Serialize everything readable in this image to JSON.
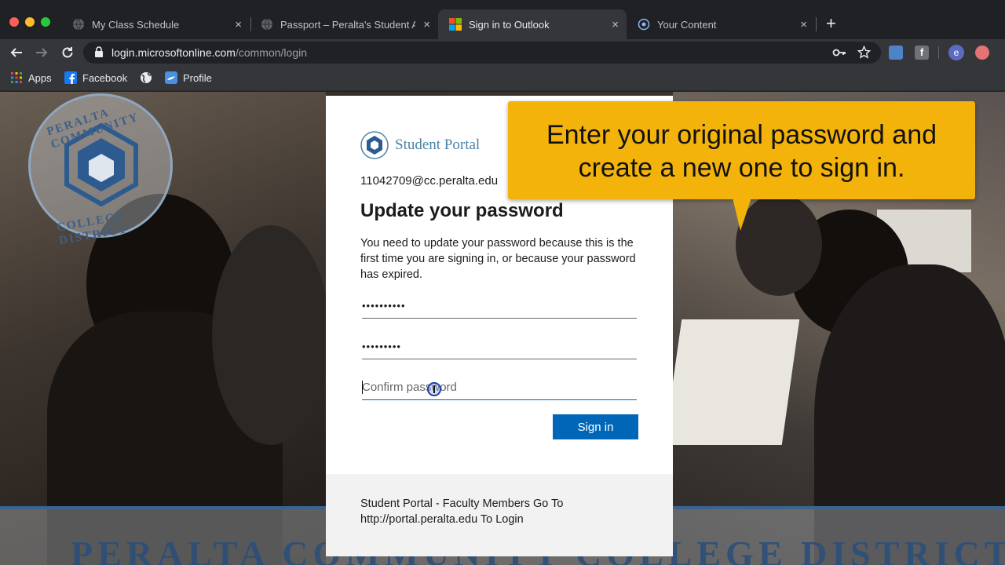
{
  "browser": {
    "tabs": [
      {
        "title": "My Class Schedule",
        "icon": "globe-icon",
        "active": false
      },
      {
        "title": "Passport – Peralta's Student Ad",
        "icon": "globe-icon",
        "active": false
      },
      {
        "title": "Sign in to Outlook",
        "icon": "microsoft-icon",
        "active": true
      },
      {
        "title": "Your Content",
        "icon": "content-icon",
        "active": false
      }
    ],
    "close_glyph": "×",
    "new_tab_glyph": "+",
    "url_host": "login.microsoftonline.com",
    "url_path": "/common/login",
    "bookmarks": [
      {
        "label": "Apps",
        "icon": "apps-grid-icon"
      },
      {
        "label": "Facebook",
        "icon": "facebook-icon"
      },
      {
        "label": "",
        "icon": "globe-icon"
      },
      {
        "label": "Profile",
        "icon": "profile-icon"
      }
    ],
    "profile_initial": "e"
  },
  "background": {
    "seal_top": "PERALTA COMMUNITY",
    "seal_bottom": "COLLEGE DISTRICT",
    "banner": "PERALTA COMMUNITY COLLEGE DISTRICT"
  },
  "card": {
    "brand_name": "Student Portal",
    "email": "11042709@cc.peralta.edu",
    "heading": "Update your password",
    "description": "You need to update your password because this is the first time you are signing in, or because your password has expired.",
    "current_password_value": "••••••••••",
    "new_password_value": "•••••••••",
    "confirm_placeholder": "Confirm password",
    "signin_label": "Sign in",
    "footer": "Student Portal - Faculty Members Go To http://portal.peralta.edu To Login"
  },
  "callout": {
    "line1": "Enter your original password and",
    "line2": "create a new one to sign in."
  },
  "colors": {
    "accent": "#0067b8",
    "callout": "#f3b30a",
    "brand": "#4a82a6"
  }
}
